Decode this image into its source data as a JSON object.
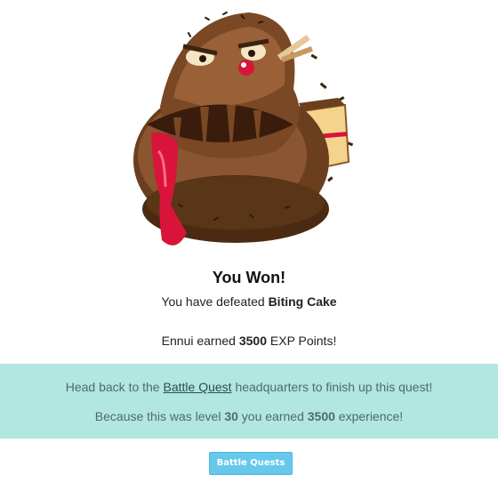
{
  "result": {
    "title": "You Won!",
    "defeat_prefix": "You have defeated",
    "monster_name": "Biting Cake",
    "earner_name": "Ennui",
    "earned_word": "earned",
    "exp_amount": "3500",
    "exp_suffix": "EXP Points!"
  },
  "banner": {
    "line1_prefix": "Head back to the",
    "link_label": "Battle Quest",
    "line1_suffix": "headquarters to finish up this quest!",
    "line2_prefix": "Because this was level",
    "level": "30",
    "line2_mid": "you earned",
    "exp": "3500",
    "line2_suffix": "experience!"
  },
  "button": {
    "label": "Battle Quests"
  },
  "colors": {
    "banner_bg": "#b2e6e1",
    "button_bg": "#66c9ec",
    "chocolate": "#6b3f1d",
    "jam": "#d8143a"
  },
  "art": {
    "icon": "biting-cake-monster"
  }
}
